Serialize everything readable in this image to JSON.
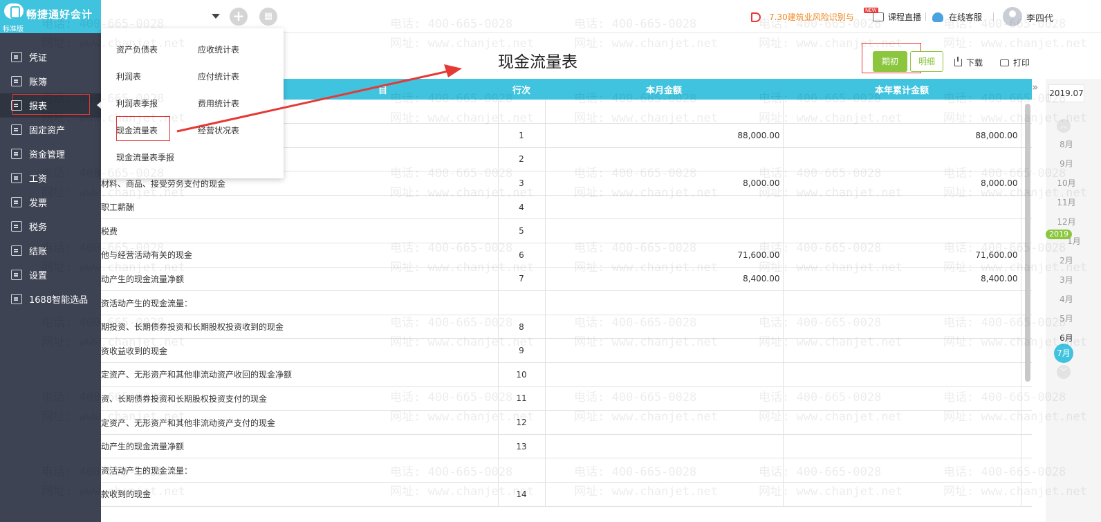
{
  "sidebar": {
    "brand": "畅捷通好会计",
    "edition": "标准版",
    "items": [
      {
        "label": "凭证",
        "icon": "voucher-icon"
      },
      {
        "label": "账簿",
        "icon": "ledger-icon"
      },
      {
        "label": "报表",
        "icon": "report-chart-icon",
        "active": true
      },
      {
        "label": "固定资产",
        "icon": "fixed-asset-icon"
      },
      {
        "label": "资金管理",
        "icon": "fund-icon"
      },
      {
        "label": "工资",
        "icon": "salary-icon"
      },
      {
        "label": "发票",
        "icon": "invoice-icon"
      },
      {
        "label": "税务",
        "icon": "tax-icon"
      },
      {
        "label": "结账",
        "icon": "close-account-icon"
      },
      {
        "label": "设置",
        "icon": "gear-icon"
      },
      {
        "label": "1688智能选品",
        "icon": "1688-icon"
      }
    ]
  },
  "topbar": {
    "add_icon": "+",
    "notice": "7.30建筑业风险识别与",
    "course_live": "课程直播",
    "online_service": "在线客服",
    "username": "李四代"
  },
  "report": {
    "title": "现金流量表",
    "btn_qichu": "期初",
    "btn_mingxi": "明细",
    "download": "下载",
    "print": "打印",
    "columns": [
      "目",
      "行次",
      "本月金额",
      "本年累计金额"
    ],
    "rows": [
      {
        "item": "",
        "line": "",
        "month": "",
        "year": ""
      },
      {
        "item": "",
        "line": "1",
        "month": "88,000.00",
        "year": "88,000.00"
      },
      {
        "item": "",
        "line": "2",
        "month": "",
        "year": ""
      },
      {
        "item": "材料、商品、接受劳务支付的现金",
        "line": "3",
        "month": "8,000.00",
        "year": "8,000.00"
      },
      {
        "item": "职工薪酬",
        "line": "4",
        "month": "",
        "year": ""
      },
      {
        "item": "税费",
        "line": "5",
        "month": "",
        "year": ""
      },
      {
        "item": "他与经营活动有关的现金",
        "line": "6",
        "month": "71,600.00",
        "year": "71,600.00"
      },
      {
        "item": "动产生的现金流量净额",
        "line": "7",
        "month": "8,400.00",
        "year": "8,400.00"
      },
      {
        "item": "资活动产生的现金流量：",
        "line": "",
        "month": "",
        "year": ""
      },
      {
        "item": "期投资、长期债券投资和长期股权投资收到的现金",
        "line": "8",
        "month": "",
        "year": ""
      },
      {
        "item": "资收益收到的现金",
        "line": "9",
        "month": "",
        "year": ""
      },
      {
        "item": "定资产、无形资产和其他非流动资产收回的现金净额",
        "line": "10",
        "month": "",
        "year": ""
      },
      {
        "item": "资、长期债券投资和长期股权投资支付的现金",
        "line": "11",
        "month": "",
        "year": ""
      },
      {
        "item": "定资产、无形资产和其他非流动资产支付的现金",
        "line": "12",
        "month": "",
        "year": ""
      },
      {
        "item": "动产生的现金流量净额",
        "line": "13",
        "month": "",
        "year": ""
      },
      {
        "item": "资活动产生的现金流量：",
        "line": "",
        "month": "",
        "year": ""
      },
      {
        "item": "款收到的现金",
        "line": "14",
        "month": "",
        "year": ""
      }
    ]
  },
  "dropdown": {
    "items": [
      {
        "label": "资产负债表"
      },
      {
        "label": "应收统计表"
      },
      {
        "label": "利润表"
      },
      {
        "label": "应付统计表"
      },
      {
        "label": "利润表季报"
      },
      {
        "label": "费用统计表"
      },
      {
        "label": "现金流量表"
      },
      {
        "label": "经营状况表"
      },
      {
        "label": "现金流量表季报"
      }
    ]
  },
  "timeline": {
    "current": "2019.07",
    "months_prev": [
      "8月",
      "9月",
      "10月",
      "11月",
      "12月"
    ],
    "year_badge": "2019",
    "months_after": [
      "1月",
      "2月",
      "3月",
      "4月",
      "5月",
      "6月"
    ],
    "selected": "7月"
  },
  "watermark": {
    "phone": "电话: 400-665-0028",
    "site": "网址: www.chanjet.net"
  },
  "colors": {
    "sidebar_bg": "#3d4353",
    "header_bg": "#3fc3de",
    "accent_green": "#8cc63f",
    "highlight_red": "#e53935"
  }
}
